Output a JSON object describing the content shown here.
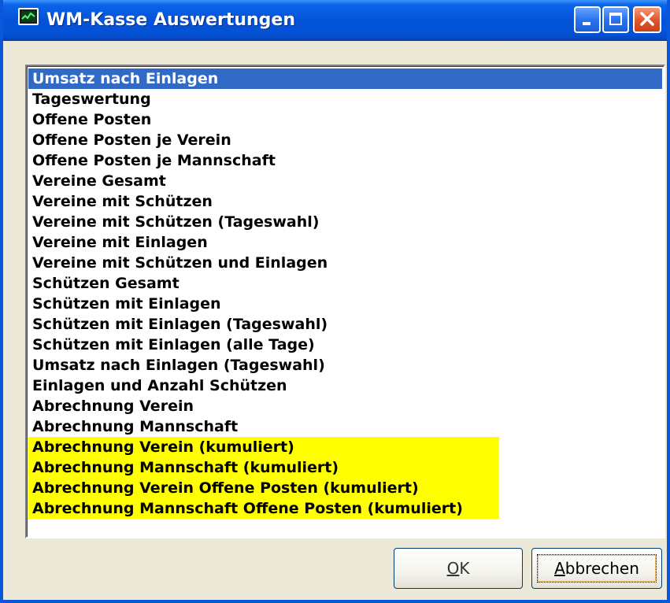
{
  "window": {
    "title": "WM-Kasse Auswertungen",
    "icon": "chart-monitor-icon"
  },
  "titlebar_buttons": {
    "minimize": "minimize-icon",
    "maximize": "maximize-icon",
    "close": "close-icon"
  },
  "list": {
    "selected_index": 0,
    "highlight_color": "#ffff00",
    "selection_color": "#3169c6",
    "items": [
      {
        "label": "Umsatz nach Einlagen",
        "state": "selected"
      },
      {
        "label": "Tageswertung",
        "state": "normal"
      },
      {
        "label": "Offene Posten",
        "state": "normal"
      },
      {
        "label": "Offene Posten je Verein",
        "state": "normal"
      },
      {
        "label": "Offene Posten je Mannschaft",
        "state": "normal"
      },
      {
        "label": "Vereine Gesamt",
        "state": "normal"
      },
      {
        "label": "Vereine mit Schützen",
        "state": "normal"
      },
      {
        "label": "Vereine mit Schützen (Tageswahl)",
        "state": "normal"
      },
      {
        "label": "Vereine mit Einlagen",
        "state": "normal"
      },
      {
        "label": "Vereine mit Schützen und Einlagen",
        "state": "normal"
      },
      {
        "label": "Schützen Gesamt",
        "state": "normal"
      },
      {
        "label": "Schützen mit Einlagen",
        "state": "normal"
      },
      {
        "label": "Schützen mit Einlagen (Tageswahl)",
        "state": "normal"
      },
      {
        "label": "Schützen mit Einlagen (alle Tage)",
        "state": "normal"
      },
      {
        "label": "Umsatz nach Einlagen (Tageswahl)",
        "state": "normal"
      },
      {
        "label": "Einlagen und Anzahl Schützen",
        "state": "normal"
      },
      {
        "label": "Abrechnung Verein",
        "state": "normal"
      },
      {
        "label": "Abrechnung Mannschaft",
        "state": "normal"
      },
      {
        "label": "Abrechnung Verein (kumuliert)",
        "state": "highlight"
      },
      {
        "label": "Abrechnung Mannschaft (kumuliert)",
        "state": "highlight"
      },
      {
        "label": "Abrechnung Verein Offene Posten (kumuliert)",
        "state": "highlight"
      },
      {
        "label": "Abrechnung Mannschaft Offene Posten (kumuliert)",
        "state": "highlight"
      }
    ]
  },
  "buttons": {
    "ok": {
      "label": "OK",
      "accelerator": "O"
    },
    "cancel": {
      "label": "Abbrechen",
      "accelerator": "A"
    }
  }
}
